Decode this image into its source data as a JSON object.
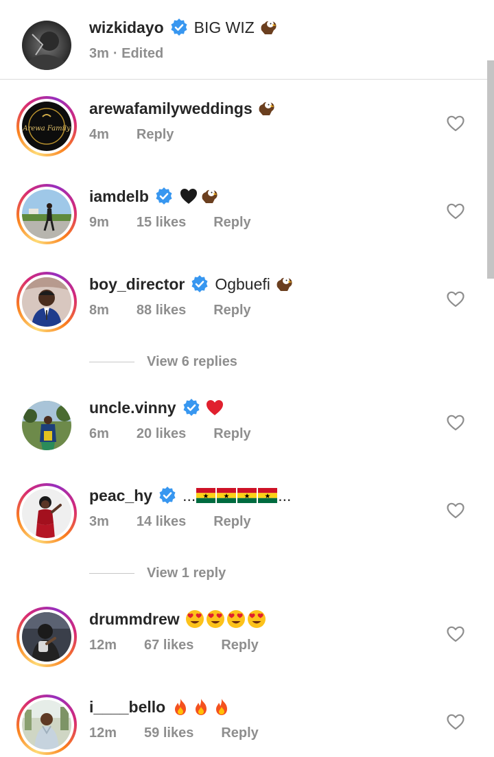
{
  "caption": {
    "username": "wizkidayo",
    "text": "BIG WIZ",
    "time": "3m",
    "edited": "· Edited"
  },
  "comments": [
    {
      "username": "arewafamilyweddings",
      "verified": false,
      "time": "4m",
      "likes": "",
      "reply": "Reply",
      "avatar_label": "Arewa Family"
    },
    {
      "username": "iamdelb",
      "verified": true,
      "time": "9m",
      "likes": "15 likes",
      "reply": "Reply"
    },
    {
      "username": "boy_director",
      "verified": true,
      "text": "Ogbuefi",
      "time": "8m",
      "likes": "88 likes",
      "reply": "Reply"
    },
    {
      "username": "uncle.vinny",
      "verified": true,
      "time": "6m",
      "likes": "20 likes",
      "reply": "Reply"
    },
    {
      "username": "peac_hy",
      "verified": true,
      "prefix": "...",
      "suffix": "...",
      "time": "3m",
      "likes": "14 likes",
      "reply": "Reply"
    },
    {
      "username": "drummdrew",
      "verified": false,
      "time": "12m",
      "likes": "67 likes",
      "reply": "Reply"
    },
    {
      "username": "i____bello",
      "verified": false,
      "time": "12m",
      "likes": "59 likes",
      "reply": "Reply"
    }
  ],
  "view_replies": [
    {
      "label": "View 6 replies"
    },
    {
      "label": "View 1 reply"
    }
  ],
  "colors": {
    "verified": "#3897f0",
    "meta_grey": "#8e8e8e",
    "divider": "#dbdbdb"
  },
  "icons": [
    "verified-badge-icon",
    "heart-outline-icon",
    "eagle-emoji",
    "black-heart-emoji",
    "red-heart-emoji",
    "ghana-flag-emoji",
    "heart-eyes-emoji",
    "fire-emoji"
  ]
}
